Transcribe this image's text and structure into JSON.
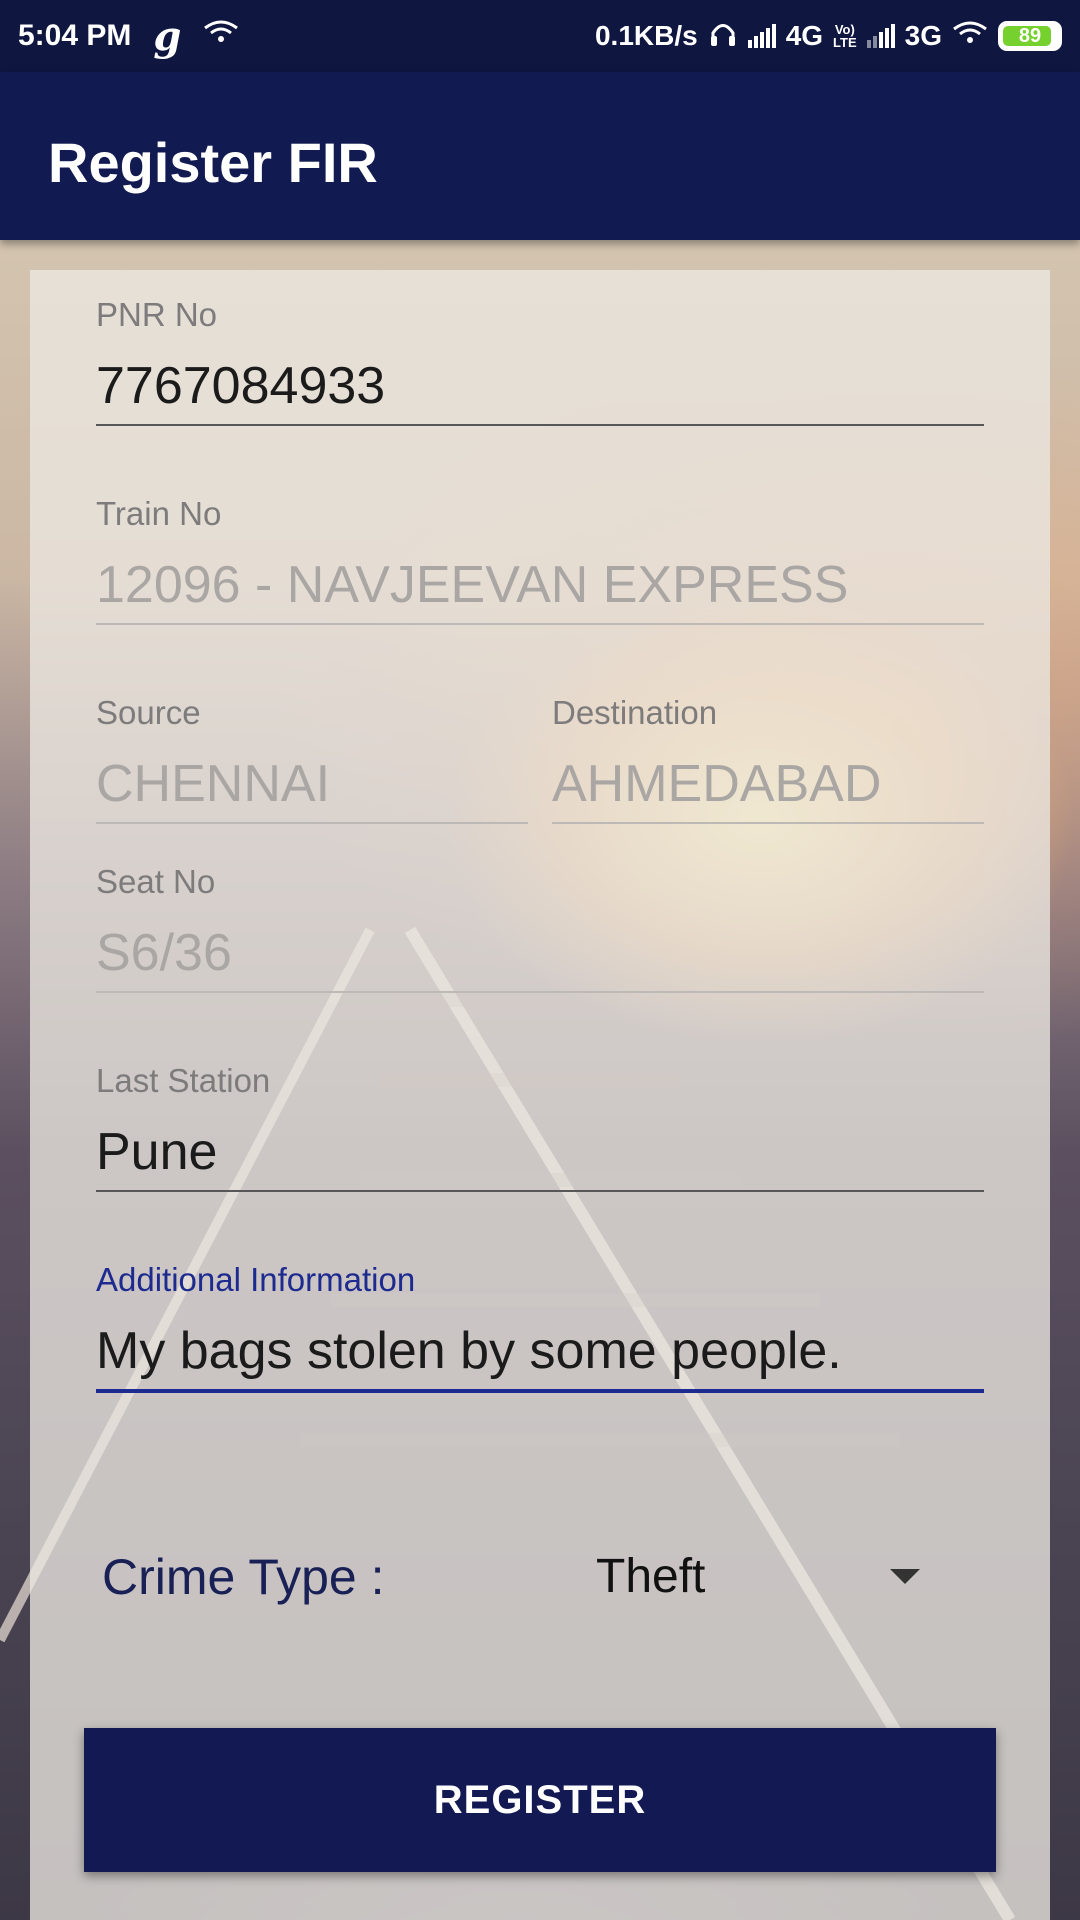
{
  "status_bar": {
    "time": "5:04 PM",
    "carrier_icon_text": "g",
    "speed": "0.1KB/s",
    "network1": "4G",
    "volte_top": "Vo)",
    "volte_bottom": "LTE",
    "network2": "3G",
    "battery": "89"
  },
  "app_bar": {
    "title": "Register FIR"
  },
  "form": {
    "pnr": {
      "label": "PNR No",
      "value": "7767084933"
    },
    "train": {
      "label": "Train No",
      "value": "12096 - NAVJEEVAN EXPRESS"
    },
    "source": {
      "label": "Source",
      "value": "CHENNAI"
    },
    "destination": {
      "label": "Destination",
      "value": "AHMEDABAD"
    },
    "seat": {
      "label": "Seat No",
      "value": "S6/36"
    },
    "last_station": {
      "label": "Last Station",
      "value": "Pune"
    },
    "additional_info": {
      "label": "Additional Information",
      "value": "My bags stolen by some people."
    },
    "crime_type": {
      "label": "Crime Type :",
      "selected": "Theft"
    },
    "register_button": "REGISTER"
  },
  "colors": {
    "primary": "#121a52",
    "status_bar": "#0f1640",
    "focus_accent": "#1d2a8f",
    "battery": "#76d12f"
  }
}
